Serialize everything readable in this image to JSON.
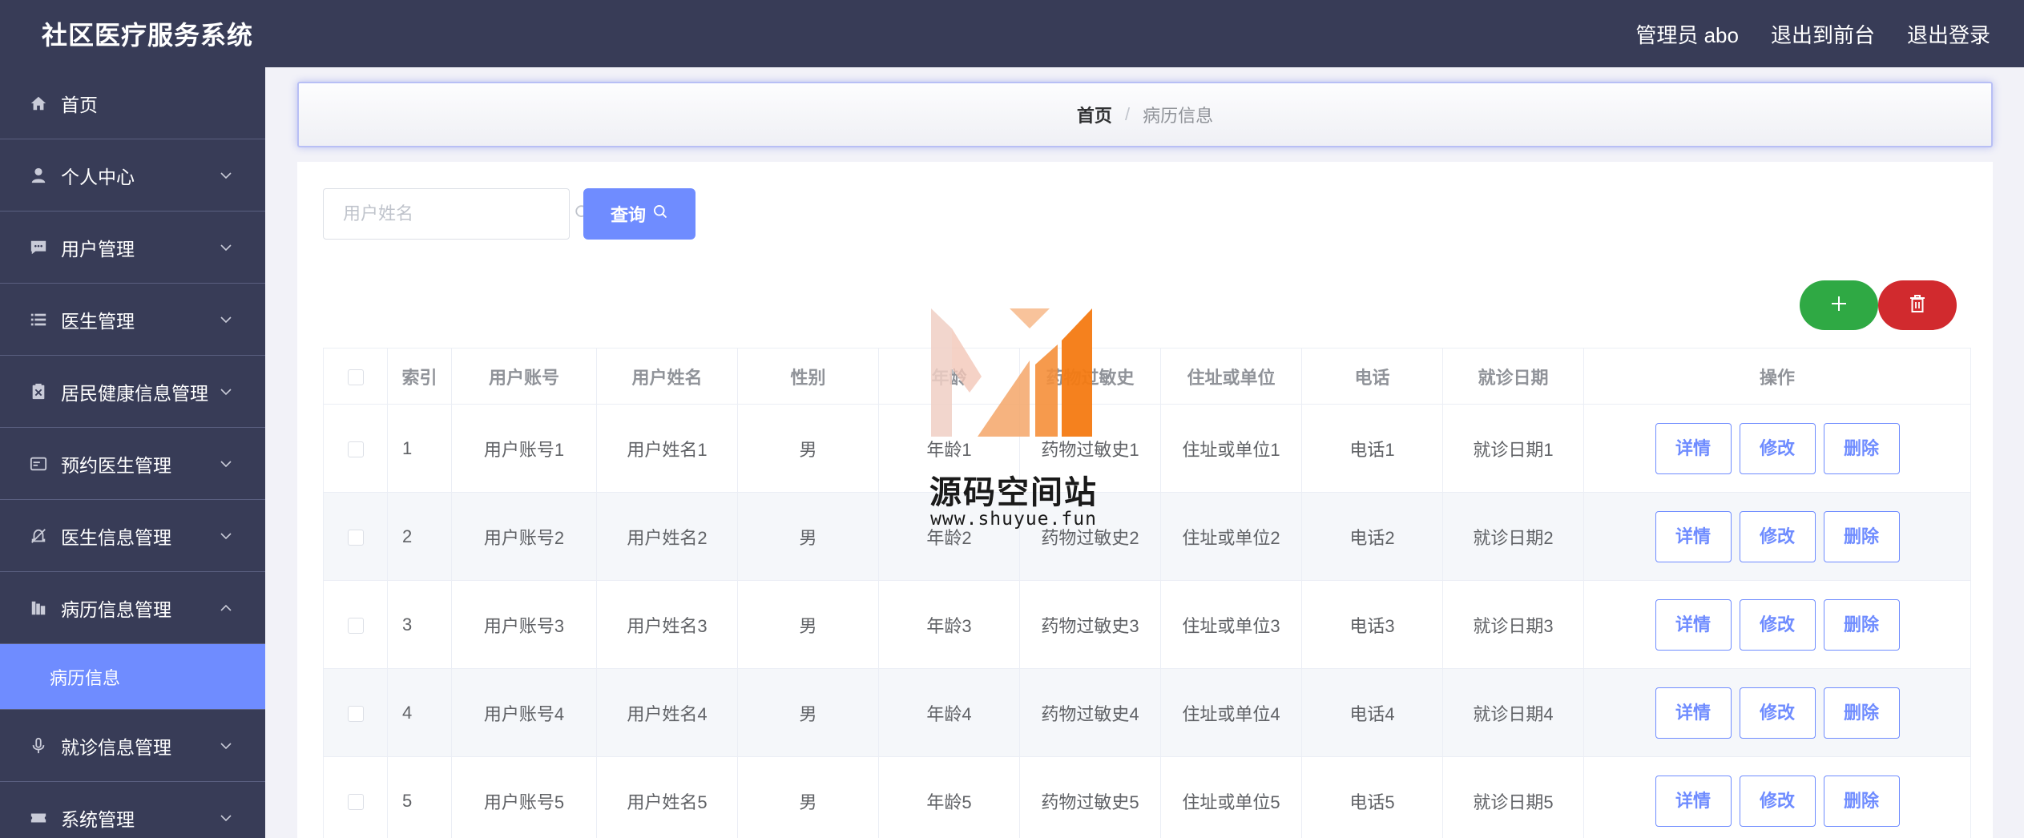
{
  "header": {
    "title": "社区医疗服务系统",
    "admin_label": "管理员 abo",
    "to_front": "退出到前台",
    "logout": "退出登录"
  },
  "sidebar": {
    "items": [
      {
        "label": "首页",
        "icon": "home-icon"
      },
      {
        "label": "个人中心",
        "icon": "user-icon"
      },
      {
        "label": "用户管理",
        "icon": "chat-icon"
      },
      {
        "label": "医生管理",
        "icon": "list-icon"
      },
      {
        "label": "居民健康信息管理",
        "icon": "clipboard-icon"
      },
      {
        "label": "预约医生管理",
        "icon": "card-icon"
      },
      {
        "label": "医生信息管理",
        "icon": "bell-off-icon"
      },
      {
        "label": "病历信息管理",
        "icon": "folder-icon"
      },
      {
        "label": "就诊信息管理",
        "icon": "microphone-icon"
      },
      {
        "label": "系统管理",
        "icon": "ticket-icon"
      }
    ],
    "active_sub": "病历信息"
  },
  "breadcrumb": {
    "home": "首页",
    "sep": "/",
    "current": "病历信息"
  },
  "search": {
    "placeholder": "用户姓名",
    "button": "查询"
  },
  "table": {
    "headers": [
      "索引",
      "用户账号",
      "用户姓名",
      "性别",
      "年龄",
      "药物过敏史",
      "住址或单位",
      "电话",
      "就诊日期",
      "操作"
    ],
    "actions": {
      "detail": "详情",
      "edit": "修改",
      "delete": "删除"
    },
    "rows": [
      {
        "idx": "1",
        "account": "用户账号1",
        "name": "用户姓名1",
        "gender": "男",
        "age": "年龄1",
        "allergy": "药物过敏史1",
        "address": "住址或单位1",
        "phone": "电话1",
        "date": "就诊日期1"
      },
      {
        "idx": "2",
        "account": "用户账号2",
        "name": "用户姓名2",
        "gender": "男",
        "age": "年龄2",
        "allergy": "药物过敏史2",
        "address": "住址或单位2",
        "phone": "电话2",
        "date": "就诊日期2"
      },
      {
        "idx": "3",
        "account": "用户账号3",
        "name": "用户姓名3",
        "gender": "男",
        "age": "年龄3",
        "allergy": "药物过敏史3",
        "address": "住址或单位3",
        "phone": "电话3",
        "date": "就诊日期3"
      },
      {
        "idx": "4",
        "account": "用户账号4",
        "name": "用户姓名4",
        "gender": "男",
        "age": "年龄4",
        "allergy": "药物过敏史4",
        "address": "住址或单位4",
        "phone": "电话4",
        "date": "就诊日期4"
      },
      {
        "idx": "5",
        "account": "用户账号5",
        "name": "用户姓名5",
        "gender": "男",
        "age": "年龄5",
        "allergy": "药物过敏史5",
        "address": "住址或单位5",
        "phone": "电话5",
        "date": "就诊日期5"
      }
    ]
  },
  "watermark": {
    "title": "源码空间站",
    "url": "www.shuyue.fun"
  },
  "colors": {
    "header_bg": "#383c57",
    "accent": "#6f8cff",
    "add": "#2fa944",
    "delete": "#d12a2e"
  }
}
